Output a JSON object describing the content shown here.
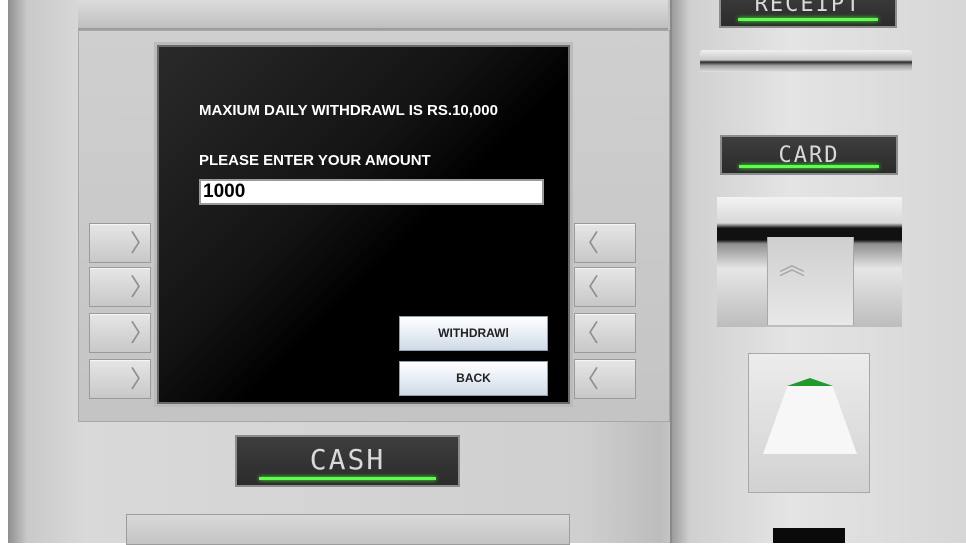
{
  "screen": {
    "limit_message": "MAXIUM DAILY WITHDRAWL IS RS.10,000",
    "prompt": "PLEASE ENTER YOUR AMOUNT",
    "amount_value": "1000",
    "withdraw_label": "WITHDRAWl",
    "back_label": "BACK"
  },
  "labels": {
    "receipt": "RECEIPT",
    "card": "CARD",
    "cash": "CASH"
  },
  "colors": {
    "indicator_green": "#5cff4a",
    "screen_bg": "#000000"
  }
}
